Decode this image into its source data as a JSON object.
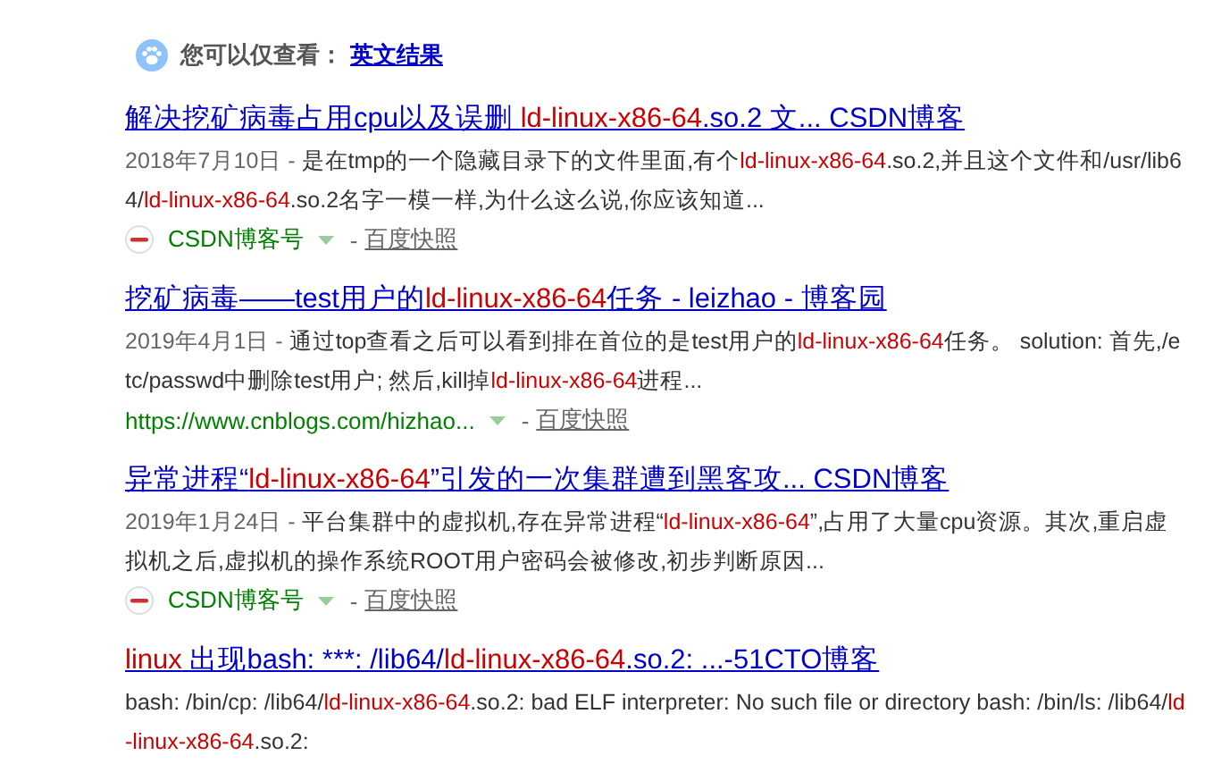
{
  "language_hint": {
    "label": "您可以仅查看：",
    "link": "英文结果"
  },
  "results": [
    {
      "title": [
        {
          "text": "解决挖矿病毒占用cpu以及误删 ",
          "highlight": false
        },
        {
          "text": "ld-linux-x86-64",
          "highlight": true
        },
        {
          "text": ".so.2 文...  CSDN博客",
          "highlight": false
        }
      ],
      "date": "2018年7月10日 -",
      "snippet": [
        {
          "text": "是在tmp的一个隐藏目录下的文件里面,有个",
          "highlight": false
        },
        {
          "text": "ld-linux-x86-64",
          "highlight": true
        },
        {
          "text": ".so.2,并且这个文件和/usr/lib64/",
          "highlight": false
        },
        {
          "text": "ld-linux-x86-64",
          "highlight": true
        },
        {
          "text": ".so.2名字一模一样,为什么这么说,你应该知道...",
          "highlight": false
        }
      ],
      "source": {
        "kind": "csdn",
        "text": "CSDN博客号"
      },
      "separator": "-",
      "cache": "百度快照"
    },
    {
      "title": [
        {
          "text": "挖矿病毒——test用户的",
          "highlight": false
        },
        {
          "text": "ld-linux-x86-64",
          "highlight": true
        },
        {
          "text": "任务 - leizhao - 博客园",
          "highlight": false
        }
      ],
      "date": "2019年4月1日 -",
      "snippet": [
        {
          "text": "通过top查看之后可以看到排在首位的是test用户的",
          "highlight": false
        },
        {
          "text": "ld-linux-x86-64",
          "highlight": true
        },
        {
          "text": "任务。 solution: 首先,/etc/passwd中删除test用户; 然后,kill掉",
          "highlight": false
        },
        {
          "text": "ld-linux-x86-64",
          "highlight": true
        },
        {
          "text": "进程...",
          "highlight": false
        }
      ],
      "source": {
        "kind": "url",
        "text": "https://www.cnblogs.com/hizhao..."
      },
      "separator": "-",
      "cache": "百度快照"
    },
    {
      "title": [
        {
          "text": "异常进程“",
          "highlight": false
        },
        {
          "text": "ld-linux-x86-64",
          "highlight": true
        },
        {
          "text": "”引发的一次集群遭到黑客攻...  CSDN博客",
          "highlight": false
        }
      ],
      "date": "2019年1月24日 -",
      "snippet": [
        {
          "text": "平台集群中的虚拟机,存在异常进程“",
          "highlight": false
        },
        {
          "text": "ld-linux-x86-64",
          "highlight": true
        },
        {
          "text": "”,占用了大量cpu资源。其次,重启虚拟机之后,虚拟机的操作系统ROOT用户密码会被修改,初步判断原因...",
          "highlight": false
        }
      ],
      "source": {
        "kind": "csdn",
        "text": "CSDN博客号"
      },
      "separator": "-",
      "cache": "百度快照"
    },
    {
      "title": [
        {
          "text": "linux",
          "highlight": true
        },
        {
          "text": " 出现bash: ***: /lib64/",
          "highlight": false
        },
        {
          "text": "ld-linux-x86-64",
          "highlight": true
        },
        {
          "text": ".so.2: ...-51CTO博客",
          "highlight": false
        }
      ],
      "snippet": [
        {
          "text": "bash: /bin/cp: /lib64/",
          "highlight": false
        },
        {
          "text": "ld-linux-x86-64",
          "highlight": true
        },
        {
          "text": ".so.2: bad ELF interpreter: No such file or directory bash: /bin/ls: /lib64/",
          "highlight": false
        },
        {
          "text": "ld-linux-x86-64",
          "highlight": true
        },
        {
          "text": ".so.2:",
          "highlight": false
        }
      ]
    }
  ]
}
